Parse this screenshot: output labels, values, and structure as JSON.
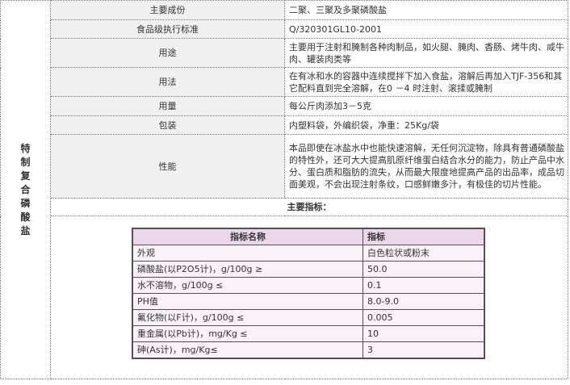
{
  "side_title": "特制复合磷酸盐",
  "rows": [
    {
      "label": "主要成份",
      "value": "二聚、三聚及多聚磷酸盐"
    },
    {
      "label": "食品级执行标准",
      "value": "Q/320301GL10-2001"
    },
    {
      "label": "用途",
      "value": "主要用于注射和腌制各种肉制品，如火腿、腌肉、香肠、烤牛肉、咸牛肉、罐装肉类等"
    },
    {
      "label": "用法",
      "value": "在有冰和水的容器中连续搅拌下加入食盐，溶解后再加入TJF-356和其它配料直到完全溶解，在0 －4 时注射、滚揉或腌制"
    },
    {
      "label": "用量",
      "value": "每公斤肉添加3－5克"
    },
    {
      "label": "包装",
      "value": "内塑料袋，外编织袋，净重：25Kg/袋"
    },
    {
      "label": "性能",
      "value": "本品即使在冰盐水中也能快速溶解，无任何沉淀物，除具有普通磷酸盐的特性外，还可大大提高肌原纤维蛋白结合水分的能力，防止产品中水分、蛋白质和脂肪的流失，从而最大限度地提高产品的出品率，成品切面美观，不会出现注射条纹，口感鲜嫩多汁，有极佳的切片性能。"
    }
  ],
  "spec_heading": "主要指标：",
  "spec_table": {
    "headers": [
      "指标名称",
      "指标"
    ],
    "rows": [
      [
        "外观",
        "白色粒状或粉末"
      ],
      [
        "磷酸盐(以P2O5计)，g/100g ≥",
        "50.0"
      ],
      [
        "水不溶物，g/100g ≤",
        "0.1"
      ],
      [
        "PH值",
        "8.0-9.0"
      ],
      [
        "氟化物(以F计)，g/100g ≤",
        "0.005"
      ],
      [
        "重金属(以Pb计)，mg/Kg ≤",
        "10"
      ],
      [
        "砷(As计)，mg/Kg≤",
        "3"
      ]
    ]
  }
}
